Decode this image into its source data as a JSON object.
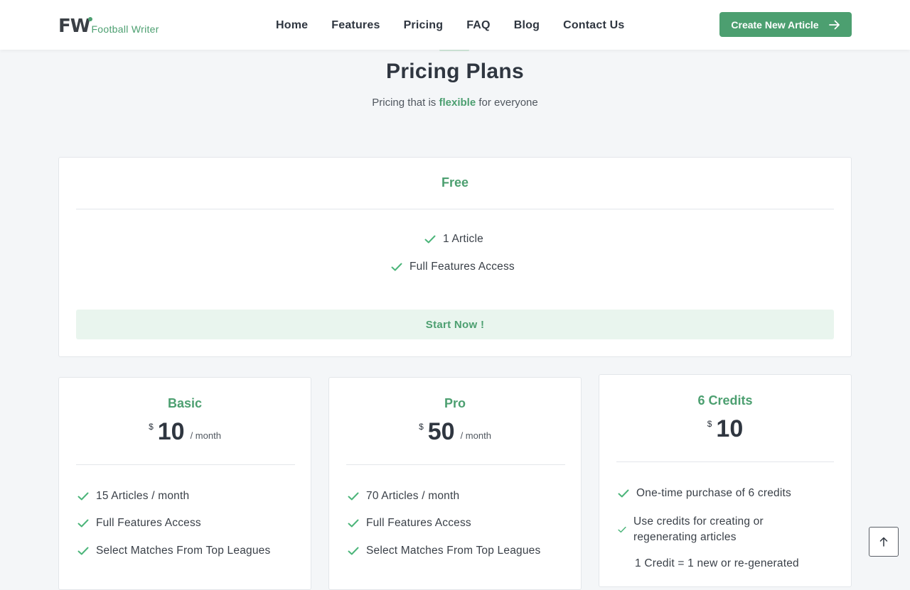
{
  "header": {
    "logo_mark": "FW",
    "logo_text": "Football Writer",
    "nav": [
      "Home",
      "Features",
      "Pricing",
      "FAQ",
      "Blog",
      "Contact Us"
    ],
    "cta_label": "Create New Article"
  },
  "section": {
    "title": "Pricing Plans",
    "subtitle_before": "Pricing that is",
    "subtitle_highlight": "flexible",
    "subtitle_after": "for everyone"
  },
  "plans": {
    "free": {
      "name": "Free",
      "features": [
        "1 Article",
        "Full Features Access"
      ],
      "button": "Start Now !"
    },
    "basic": {
      "name": "Basic",
      "currency": "$",
      "amount": "10",
      "period": "/ month",
      "features": [
        "15 Articles / month",
        "Full Features Access",
        "Select Matches From Top Leagues"
      ]
    },
    "pro": {
      "name": "Pro",
      "currency": "$",
      "amount": "50",
      "period": "/ month",
      "features": [
        "70 Articles / month",
        "Full Features Access",
        "Select Matches From Top Leagues"
      ]
    },
    "credits": {
      "name": "6 Credits",
      "currency": "$",
      "amount": "10",
      "features": [
        "One-time purchase of 6 credits",
        "Use credits for creating or regenerating articles",
        "1 Credit = 1 new or re-generated"
      ]
    }
  },
  "colors": {
    "accent": "#4c9f70",
    "check": "#4cb57a",
    "background": "#f4f6f8"
  },
  "icons": {
    "cta": "arrow-right-icon",
    "feature": "check-icon",
    "scroll": "arrow-up-icon"
  }
}
